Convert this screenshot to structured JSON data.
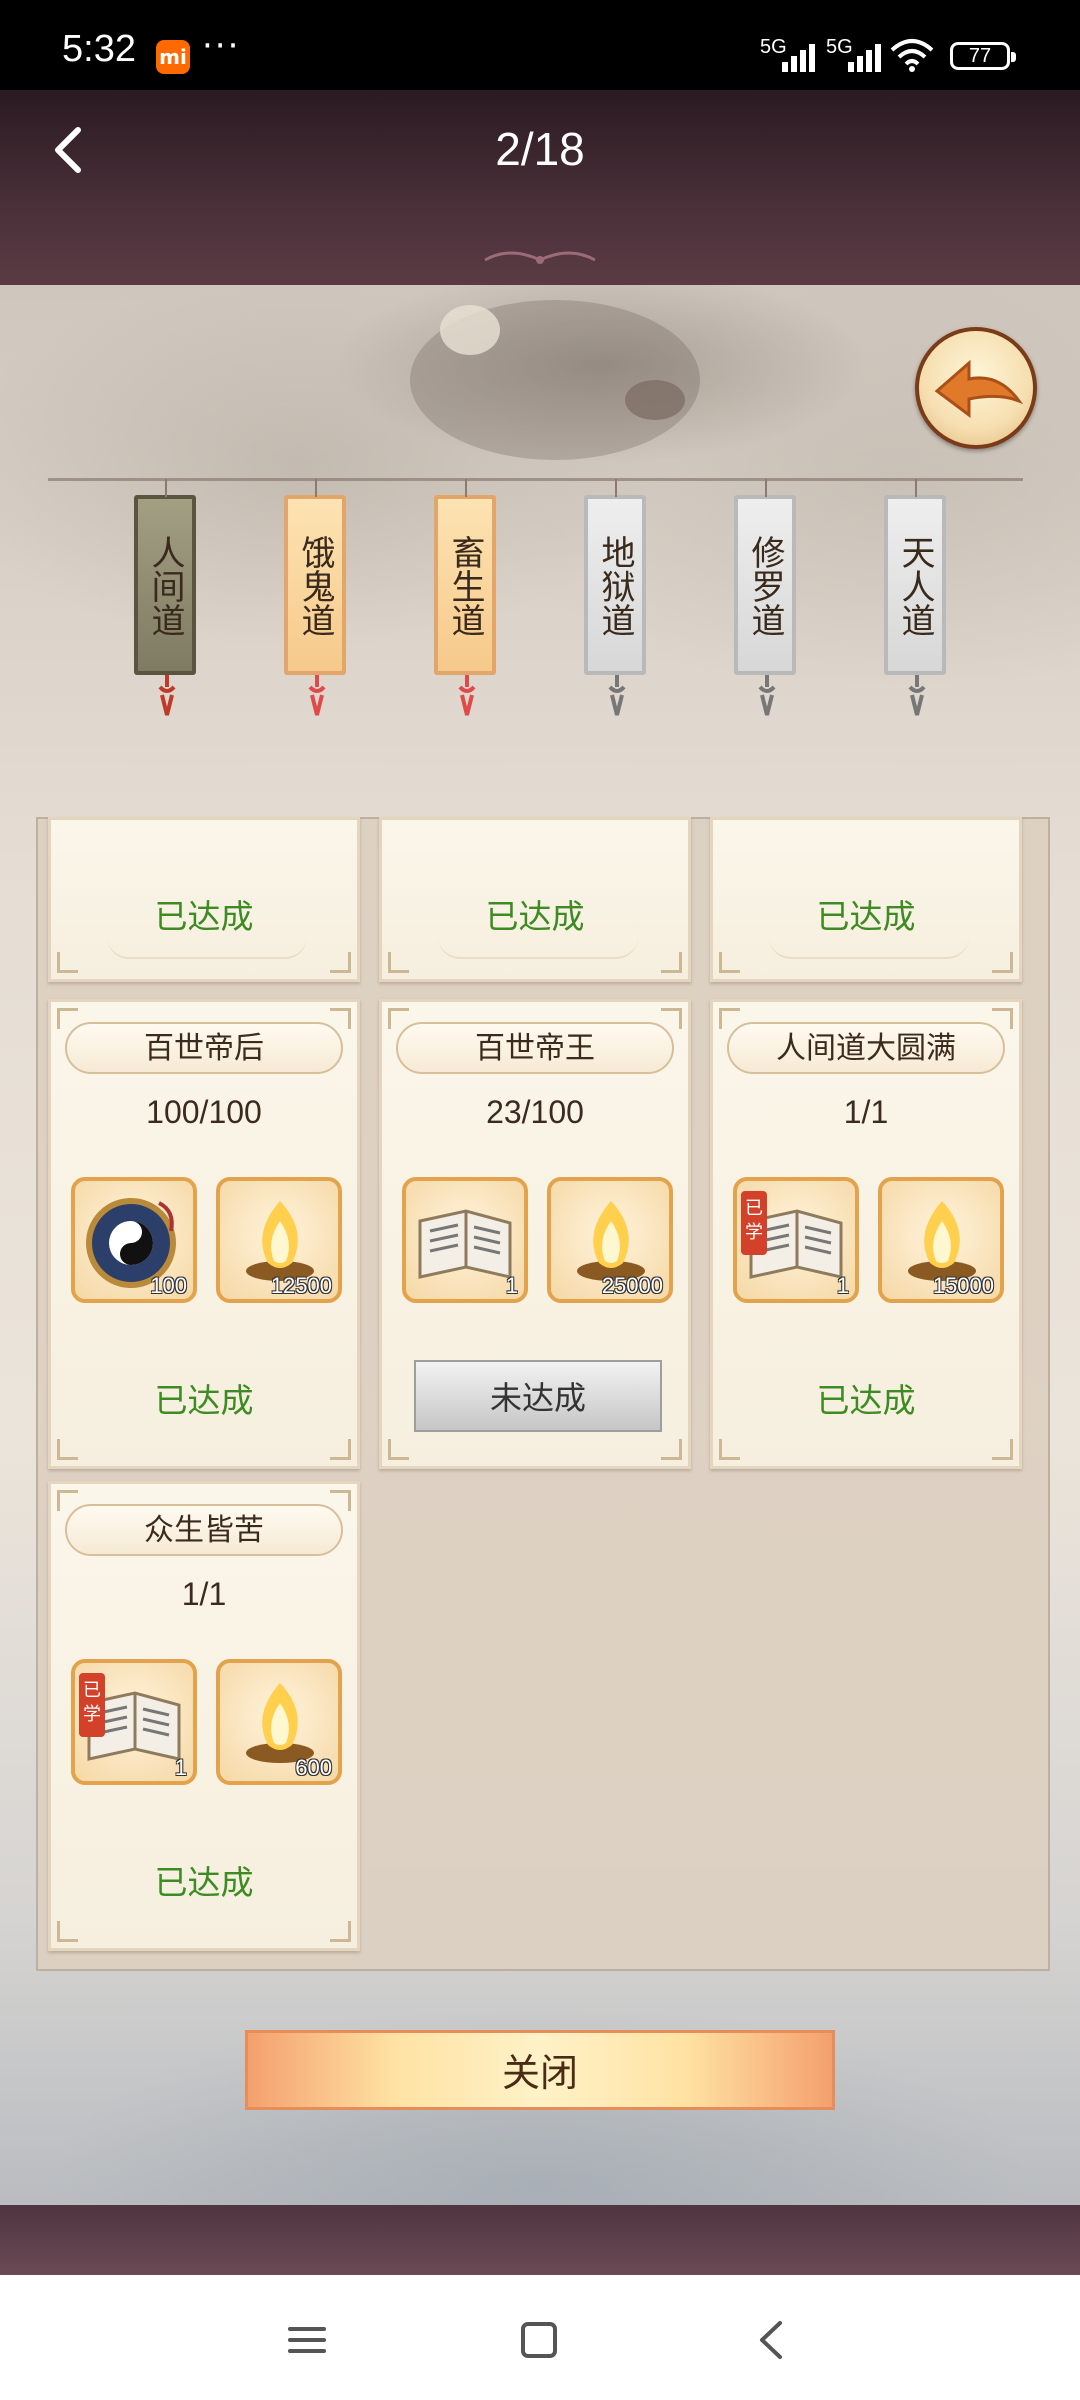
{
  "status_bar": {
    "time": "5:32",
    "mi_badge": "mi",
    "more": "···",
    "signal1": "5G",
    "signal2": "5G",
    "battery": "77"
  },
  "header": {
    "title": "2/18"
  },
  "tabs": [
    {
      "label": "人间道",
      "state": "selected"
    },
    {
      "label": "饿鬼道",
      "state": "unlocked"
    },
    {
      "label": "畜生道",
      "state": "unlocked"
    },
    {
      "label": "地狱道",
      "state": "locked"
    },
    {
      "label": "修罗道",
      "state": "locked"
    },
    {
      "label": "天人道",
      "state": "locked"
    }
  ],
  "cards_top_row": [
    {
      "status": "已达成"
    },
    {
      "status": "已达成"
    },
    {
      "status": "已达成"
    }
  ],
  "cards": [
    {
      "title": "百世帝后",
      "progress": "100/100",
      "status": "已达成",
      "items": [
        {
          "icon": "taiji-compass-icon",
          "qty": "100"
        },
        {
          "icon": "spirit-flame-icon",
          "qty": "12500"
        }
      ]
    },
    {
      "title": "百世帝王",
      "progress": "23/100",
      "status": "未达成",
      "items": [
        {
          "icon": "skill-book-icon",
          "qty": "1"
        },
        {
          "icon": "spirit-flame-icon",
          "qty": "25000"
        }
      ]
    },
    {
      "title": "人间道大圆满",
      "progress": "1/1",
      "status": "已达成",
      "items": [
        {
          "icon": "skill-book-icon",
          "qty": "1",
          "learned": "已学"
        },
        {
          "icon": "spirit-flame-icon",
          "qty": "15000"
        }
      ]
    },
    {
      "title": "众生皆苦",
      "progress": "1/1",
      "status": "已达成",
      "items": [
        {
          "icon": "skill-book-icon",
          "qty": "1",
          "learned": "已学"
        },
        {
          "icon": "spirit-flame-icon",
          "qty": "600"
        }
      ]
    }
  ],
  "close_button": "关闭",
  "colors": {
    "achieved": "#3d8b22",
    "item_border": "#e3a24c",
    "header_bg": "#4a3039"
  }
}
